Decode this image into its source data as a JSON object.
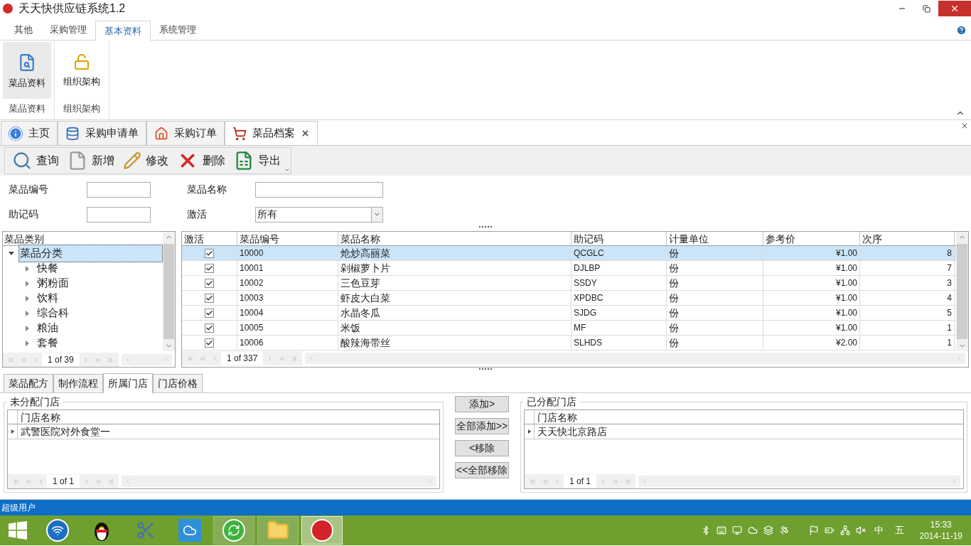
{
  "window": {
    "title": "天天快供应链系统1.2"
  },
  "ribbon": {
    "tabs": [
      {
        "label": "其他",
        "selected": false
      },
      {
        "label": "采购管理",
        "selected": false
      },
      {
        "label": "基本资料",
        "selected": true
      },
      {
        "label": "系统管理",
        "selected": false
      }
    ],
    "groups": [
      {
        "button": "菜品资料",
        "label": "菜品资料",
        "kind": "search-doc",
        "selected": true
      },
      {
        "button": "组织架构",
        "label": "组织架构",
        "kind": "lock",
        "selected": false
      }
    ]
  },
  "doc_tabs": [
    {
      "label": "主页",
      "kind": "info",
      "selected": false,
      "closable": false
    },
    {
      "label": "采购申请单",
      "kind": "database",
      "selected": false,
      "closable": false
    },
    {
      "label": "采购订单",
      "kind": "home",
      "selected": false,
      "closable": false
    },
    {
      "label": "菜品档案",
      "kind": "cart",
      "selected": true,
      "closable": true
    }
  ],
  "toolbar": [
    {
      "label": "查询",
      "kind": "search"
    },
    {
      "label": "新增",
      "kind": "new"
    },
    {
      "label": "修改",
      "kind": "edit"
    },
    {
      "label": "删除",
      "kind": "delete"
    },
    {
      "label": "导出",
      "kind": "excel"
    }
  ],
  "filters": [
    {
      "label": "菜品编号",
      "kind": "text"
    },
    {
      "label": "菜品名称",
      "kind": "text"
    },
    {
      "label": "助记码",
      "kind": "text"
    },
    {
      "label": "激活",
      "kind": "select",
      "value": "所有"
    }
  ],
  "category_tree": {
    "header": "菜品类别",
    "nodes": [
      {
        "label": "菜品分类",
        "selected": true,
        "expanded": true,
        "children": [
          {
            "label": "快餐",
            "selected": false,
            "expanded": false
          },
          {
            "label": "粥粉面",
            "selected": false,
            "expanded": false
          },
          {
            "label": "饮料",
            "selected": false,
            "expanded": false
          },
          {
            "label": "综合科",
            "selected": false,
            "expanded": false
          },
          {
            "label": "粮油",
            "selected": false,
            "expanded": false
          },
          {
            "label": "套餐",
            "selected": false,
            "expanded": false
          }
        ]
      }
    ],
    "pager": "1 of 39"
  },
  "products": {
    "columns": [
      "激活",
      "菜品编号",
      "菜品名称",
      "助记码",
      "计量单位",
      "参考价",
      "次序"
    ],
    "rows": [
      {
        "selected": true,
        "active": true,
        "code": "10000",
        "name": "炝炒高丽菜",
        "mnemonic": "QCGLC",
        "unit": "份",
        "price": "¥1.00",
        "order": "8"
      },
      {
        "selected": false,
        "active": true,
        "code": "10001",
        "name": "剁椒萝卜片",
        "mnemonic": "DJLBP",
        "unit": "份",
        "price": "¥1.00",
        "order": "7"
      },
      {
        "selected": false,
        "active": true,
        "code": "10002",
        "name": "三色豆芽",
        "mnemonic": "SSDY",
        "unit": "份",
        "price": "¥1.00",
        "order": "3"
      },
      {
        "selected": false,
        "active": true,
        "code": "10003",
        "name": "虾皮大白菜",
        "mnemonic": "XPDBC",
        "unit": "份",
        "price": "¥1.00",
        "order": "4"
      },
      {
        "selected": false,
        "active": true,
        "code": "10004",
        "name": "水晶冬瓜",
        "mnemonic": "SJDG",
        "unit": "份",
        "price": "¥1.00",
        "order": "5"
      },
      {
        "selected": false,
        "active": true,
        "code": "10005",
        "name": "米饭",
        "mnemonic": "MF",
        "unit": "份",
        "price": "¥1.00",
        "order": "1"
      },
      {
        "selected": false,
        "active": true,
        "code": "10006",
        "name": "酸辣海带丝",
        "mnemonic": "SLHDS",
        "unit": "份",
        "price": "¥2.00",
        "order": "1"
      }
    ],
    "pager": "1 of 337"
  },
  "detail_tabs": [
    {
      "label": "菜品配方",
      "selected": false
    },
    {
      "label": "制作流程",
      "selected": false
    },
    {
      "label": "所属门店",
      "selected": true
    },
    {
      "label": "门店价格",
      "selected": false
    }
  ],
  "unassigned_stores": {
    "title": "未分配门店",
    "column": "门店名称",
    "rows": [
      "武警医院对外食堂一"
    ],
    "pager": "1 of 1"
  },
  "transfer_buttons": [
    "添加>",
    "全部添加>>",
    "<移除",
    "<<全部移除"
  ],
  "assigned_stores": {
    "title": "已分配门店",
    "column": "门店名称",
    "rows": [
      "天天快北京路店"
    ],
    "pager": "1 of 1"
  },
  "status_bar": "超级用户",
  "taskbar": {
    "apps": [
      {
        "kind": "wifi",
        "running": false,
        "selected": false
      },
      {
        "kind": "penguin",
        "running": false,
        "selected": false
      },
      {
        "kind": "scissors",
        "running": false,
        "selected": false
      },
      {
        "kind": "cloud",
        "running": false,
        "selected": false
      },
      {
        "kind": "refresh",
        "running": true,
        "selected": false
      },
      {
        "kind": "folder",
        "running": true,
        "selected": false
      },
      {
        "kind": "app",
        "running": true,
        "selected": true
      }
    ],
    "tray": {
      "ime": [
        "中",
        "五"
      ],
      "time": "15:33",
      "date": "2014-11-19"
    }
  }
}
